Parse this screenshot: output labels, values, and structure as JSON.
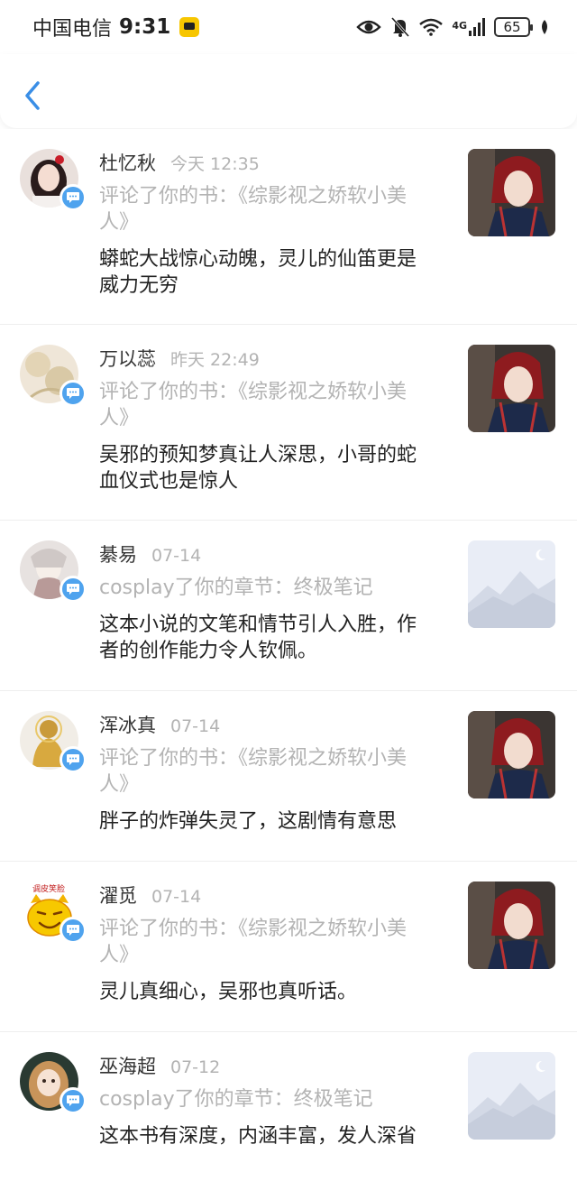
{
  "status_bar": {
    "carrier": "中国电信",
    "time": "9:31",
    "network": "4G",
    "battery": "65"
  },
  "nav": {
    "back_icon": "chevron-left-icon"
  },
  "colors": {
    "accent": "#3a8ee6",
    "badge": "#4fa3ee",
    "muted_text": "#b3b3b3"
  },
  "notifications": [
    {
      "name": "杜忆秋",
      "time": "今天 12:35",
      "action": "评论了你的书：《综影视之娇软小美人》",
      "comment": "蟒蛇大战惊心动魄，灵儿的仙笛更是威力无穷",
      "thumb": "book-cover"
    },
    {
      "name": "万以蕊",
      "time": "昨天 22:49",
      "action": "评论了你的书：《综影视之娇软小美人》",
      "comment": "吴邪的预知梦真让人深思，小哥的蛇血仪式也是惊人",
      "thumb": "book-cover"
    },
    {
      "name": "綦易",
      "time": "07-14",
      "action": "cosplay了你的章节：终极笔记",
      "comment": "这本小说的文笔和情节引人入胜，作者的创作能力令人钦佩。",
      "thumb": "placeholder"
    },
    {
      "name": "浑冰真",
      "time": "07-14",
      "action": "评论了你的书：《综影视之娇软小美人》",
      "comment": "胖子的炸弹失灵了，这剧情有意思",
      "thumb": "book-cover"
    },
    {
      "name": "濯觅",
      "time": "07-14",
      "action": "评论了你的书：《综影视之娇软小美人》",
      "comment": "灵儿真细心，吴邪也真听话。",
      "thumb": "book-cover",
      "avatar_caption": "调皮笑脸"
    },
    {
      "name": "巫海超",
      "time": "07-12",
      "action": "cosplay了你的章节：终极笔记",
      "comment": "这本书有深度，内涵丰富，发人深省",
      "thumb": "placeholder"
    }
  ]
}
